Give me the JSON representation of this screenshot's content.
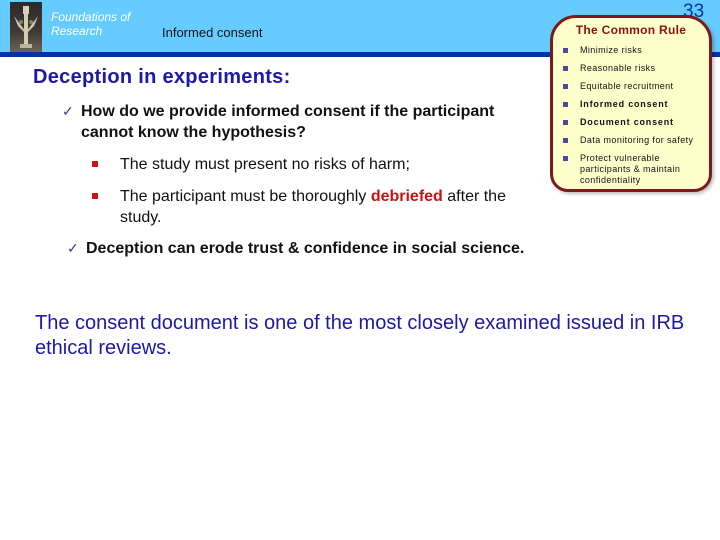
{
  "header": {
    "course_title_line1": "Foundations of",
    "course_title_line2": "Research",
    "topic": "Informed consent",
    "page_number": "33",
    "logo_icon": "statue-figurine-icon"
  },
  "common_rule": {
    "title": "The Common Rule",
    "items": [
      {
        "label": "Minimize risks",
        "bold": false
      },
      {
        "label": "Reasonable risks",
        "bold": false
      },
      {
        "label": "Equitable recruitment",
        "bold": false
      },
      {
        "label": "Informed consent",
        "bold": true
      },
      {
        "label": "Document consent",
        "bold": true
      },
      {
        "label": "Data monitoring for safety",
        "bold": false
      },
      {
        "label": "Protect vulnerable participants & maintain confidentiality",
        "bold": false
      }
    ]
  },
  "main": {
    "heading": "Deception in experiments:",
    "check1": {
      "text": "How do we provide informed consent if the participant cannot know the hypothesis?"
    },
    "sub_items": [
      {
        "text": "The study must present no risks of harm;"
      },
      {
        "before": "The participant must be thoroughly ",
        "highlight": "debriefed",
        "after": " after the study."
      }
    ],
    "check2": {
      "text": "Deception can erode trust & confidence in social science."
    },
    "summary": "The consent document is one of the most closely examined issued in IRB ethical reviews."
  },
  "colors": {
    "header_band": "#66ccff",
    "header_line": "#0033aa",
    "heading_blue": "#1a1aa6",
    "highlight_red": "#cc1111",
    "rule_box_fill": "#ffffcc",
    "rule_box_border": "#7a1a1a"
  }
}
